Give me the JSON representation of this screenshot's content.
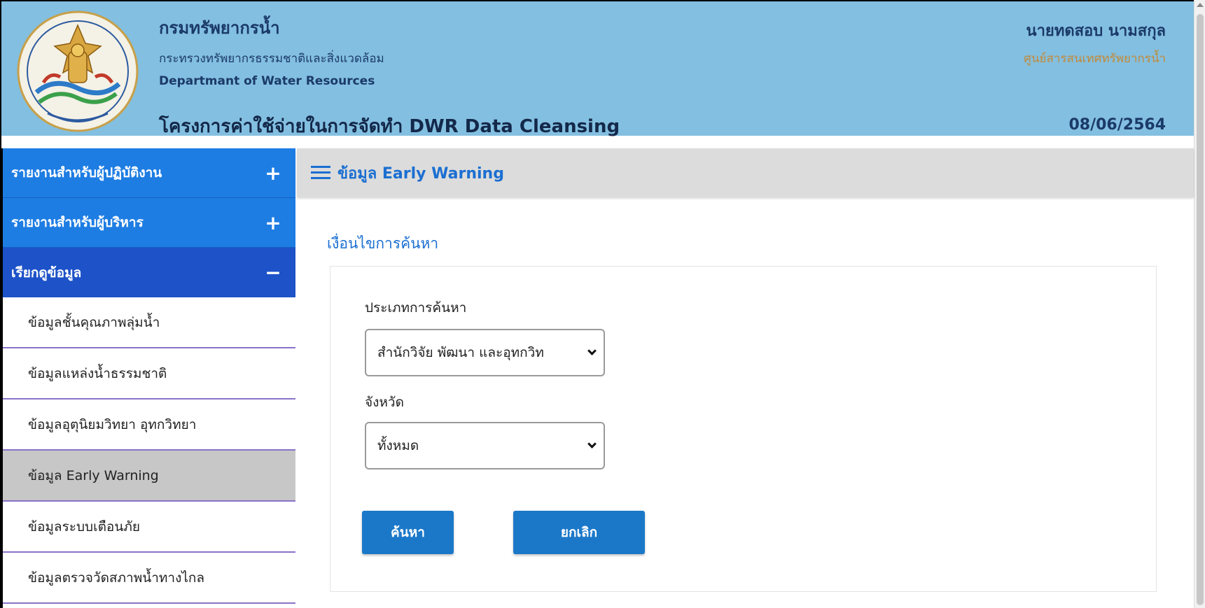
{
  "header": {
    "org_name": "กรมทรัพยากรน้ำ",
    "ministry": "กระทรวงทรัพยากรธรรมชาติและสิ่งแวดล้อม",
    "org_name_en": "Departmant of Water Resources",
    "project_title": "โครงการค่าใช้จ่ายในการจัดทำ DWR Data Cleansing",
    "user_name": "นายทดสอบ นามสกุล",
    "user_unit": "ศูนย์สารสนเทศทรัพยากรน้ำ",
    "date": "08/06/2564",
    "logo_icon": "dwr-emblem-logo"
  },
  "sidebar": {
    "sections": [
      {
        "label": "รายงานสำหรับผู้ปฏิบัติงาน",
        "sign": "+",
        "expanded": false
      },
      {
        "label": "รายงานสำหรับผู้บริหาร",
        "sign": "+",
        "expanded": false
      },
      {
        "label": "เรียกดูข้อมูล",
        "sign": "−",
        "expanded": true
      }
    ],
    "items": [
      {
        "label": "ข้อมูลชั้นคุณภาพลุ่มน้ำ"
      },
      {
        "label": "ข้อมูลแหล่งน้ำธรรมชาติ"
      },
      {
        "label": "ข้อมูลอุตุนิยมวิทยา อุทกวิทยา"
      },
      {
        "label": "ข้อมูล Early Warning",
        "active": true
      },
      {
        "label": "ข้อมูลระบบเตือนภัย"
      },
      {
        "label": "ข้อมูลตรวจวัดสภาพน้ำทางไกล"
      }
    ]
  },
  "main": {
    "page_title": "ข้อมูล Early Warning",
    "search_heading": "เงื่อนไขการค้นหา",
    "search_type_label": "ประเภทการค้นหา",
    "search_type_value": "สำนักวิจัย พัฒนา และอุทกวิท",
    "province_label": "จังหวัด",
    "province_value": "ทั้งหมด",
    "search_button": "ค้นหา",
    "cancel_button": "ยกเลิก"
  },
  "colors": {
    "header_bg": "#83bfe0",
    "sidebar_section": "#1e7de3",
    "sidebar_section_active": "#1d52c8",
    "accent": "#1b6fd1",
    "button": "#1b78c9",
    "item_divider": "#8a72c8"
  }
}
